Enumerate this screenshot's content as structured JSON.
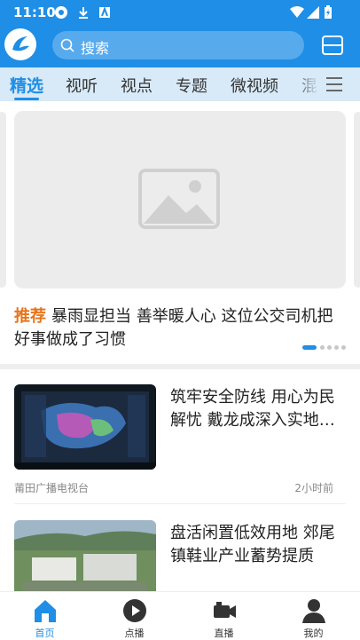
{
  "status_bar": {
    "time": "11:10"
  },
  "header": {
    "search_placeholder": "搜索"
  },
  "tabs": [
    {
      "label": "精选"
    },
    {
      "label": "视听"
    },
    {
      "label": "视点"
    },
    {
      "label": "专题"
    },
    {
      "label": "微视频"
    },
    {
      "label": "混"
    }
  ],
  "hero": {
    "tag": "推荐",
    "headline": "暴雨显担当 善举暖人心 这位公交司机把好事做成了习惯"
  },
  "news": [
    {
      "title": "筑牢安全防线 用心为民解忧 戴龙成深入实地…",
      "source": "莆田广播电视台",
      "time": "2小时前"
    },
    {
      "title": "盘活闲置低效用地 郊尾镇鞋业产业蓄势提质",
      "source": "",
      "time": ""
    }
  ],
  "bottom_nav": [
    {
      "label": "首页"
    },
    {
      "label": "点播"
    },
    {
      "label": "直播"
    },
    {
      "label": "我的"
    }
  ],
  "colors": {
    "accent": "#1f8ee6",
    "tag": "#e8741b"
  }
}
